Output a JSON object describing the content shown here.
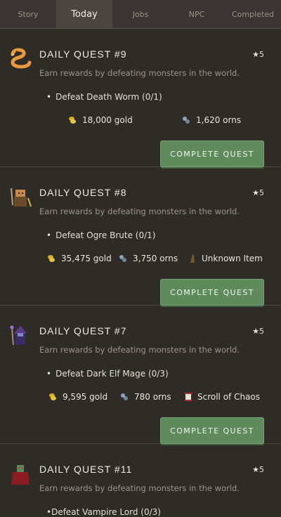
{
  "tabs": [
    {
      "label": "Story",
      "active": false
    },
    {
      "label": "Today",
      "active": true
    },
    {
      "label": "Jobs",
      "active": false
    },
    {
      "label": "NPC",
      "active": false
    },
    {
      "label": "Completed",
      "active": false
    }
  ],
  "quests": [
    {
      "title": "DAILY QUEST #9",
      "stars": "★5",
      "description": "Earn rewards by defeating monsters in the world.",
      "task": "Defeat Death Worm (0/1)",
      "rewards": [
        {
          "icon": "gold-coins-icon",
          "text": "18,000 gold"
        },
        {
          "icon": "orns-icon",
          "text": "1,620 orns"
        }
      ],
      "button": "COMPLETE QUEST",
      "portrait": "death-worm-portrait"
    },
    {
      "title": "DAILY QUEST #8",
      "stars": "★5",
      "description": "Earn rewards by defeating monsters in the world.",
      "task": "Defeat Ogre Brute (0/1)",
      "rewards": [
        {
          "icon": "gold-coins-icon",
          "text": "35,475 gold"
        },
        {
          "icon": "orns-icon",
          "text": "3,750 orns"
        },
        {
          "icon": "unknown-item-icon",
          "text": "Unknown Item"
        }
      ],
      "button": "COMPLETE QUEST",
      "portrait": "ogre-brute-portrait"
    },
    {
      "title": "DAILY QUEST #7",
      "stars": "★5",
      "description": "Earn rewards by defeating monsters in the world.",
      "task": "Defeat Dark Elf Mage (0/3)",
      "rewards": [
        {
          "icon": "gold-coins-icon",
          "text": "9,595 gold"
        },
        {
          "icon": "orns-icon",
          "text": "780 orns"
        },
        {
          "icon": "scroll-icon",
          "text": "Scroll of Chaos"
        }
      ],
      "button": "COMPLETE QUEST",
      "portrait": "dark-elf-mage-portrait"
    },
    {
      "title": "DAILY QUEST #11",
      "stars": "★5",
      "description": "Earn rewards by defeating monsters in the world.",
      "task": "Defeat Vampire Lord (0/3)",
      "portrait": "vampire-lord-portrait"
    }
  ]
}
